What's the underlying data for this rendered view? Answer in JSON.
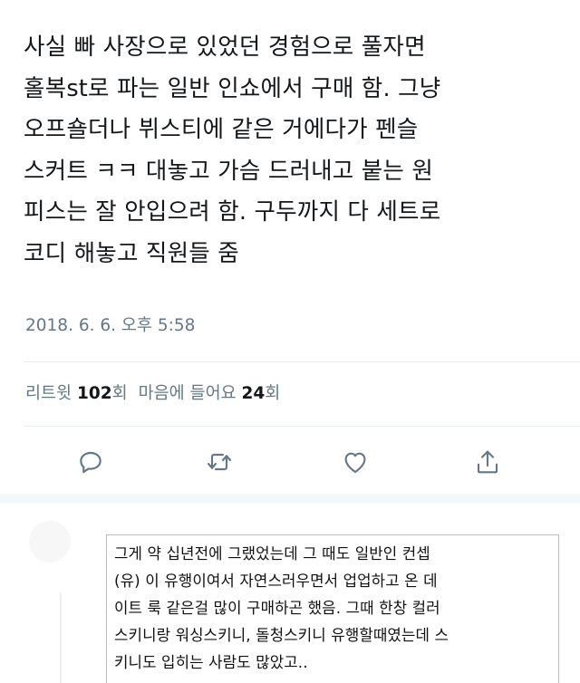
{
  "tweet": {
    "text": "사실 빠 사장으로 있었던 경험으로 풀자면\n홀복st로 파는 일반 인쇼에서 구매 함. 그냥\n오프숄더나 뷔스티에 같은 거에다가 펜슬\n스커트 ㅋㅋ 대놓고 가슴 드러내고 붙는 원\n피스는 잘 안입으려 함. 구두까지 다 세트로\n코디 해놓고 직원들 줌",
    "timestamp": "2018. 6. 6. 오후 5:58"
  },
  "stats": {
    "retweet_label": "리트윗",
    "retweet_count": "102",
    "retweet_unit": "회",
    "like_label": "마음에 들어요",
    "like_count": "24",
    "like_unit": "회"
  },
  "actions": {
    "reply_icon": "reply-icon",
    "retweet_icon": "retweet-icon",
    "like_icon": "heart-icon",
    "share_icon": "share-icon",
    "icon_color": "#657786"
  },
  "reply": {
    "text": "그게 약 십년전에 그랬었는데 그 때도 일반인 컨셉\n(유) 이 유행이여서 자연스러우면서 업업하고 온 데\n이트 룩 같은걸 많이 구매하곤 했음. 그때 한창 컬러\n스키니랑 워싱스키니, 돌청스키니 유행할때였는데 스\n키니도 입히는 사람도 많았고.."
  }
}
